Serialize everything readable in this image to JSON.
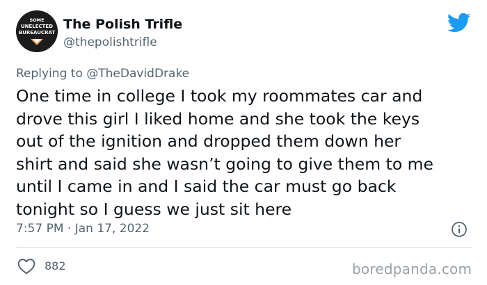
{
  "author": {
    "display_name": "The Polish Trifle",
    "handle": "@thepolishtrifle",
    "avatar_text": [
      "SOME",
      "UNELECTED",
      "BUREAUCRAT"
    ]
  },
  "reply": {
    "prefix": "Replying to ",
    "mention": "@TheDavidDrake"
  },
  "tweet": {
    "text": "One time in college I took my roommates car and\ndrove this girl I liked home and she took the keys\nout of the ignition and dropped them down her\nshirt and said she wasn’t going to give them to me\nuntil I came in and I said the car must go back\ntonight so I guess we just sit here",
    "timestamp": "7:57 PM · Jan 17, 2022"
  },
  "stats": {
    "likes": "882"
  },
  "watermark": "boredpanda.com",
  "icons": {
    "brand": "twitter-bird-icon",
    "info": "info-icon",
    "like": "heart-icon"
  },
  "colors": {
    "twitter_blue": "#1d9bf0",
    "secondary_text": "#536471",
    "primary_text": "#0f1419",
    "divider": "#cfd9de",
    "watermark": "#9aa0a6"
  }
}
